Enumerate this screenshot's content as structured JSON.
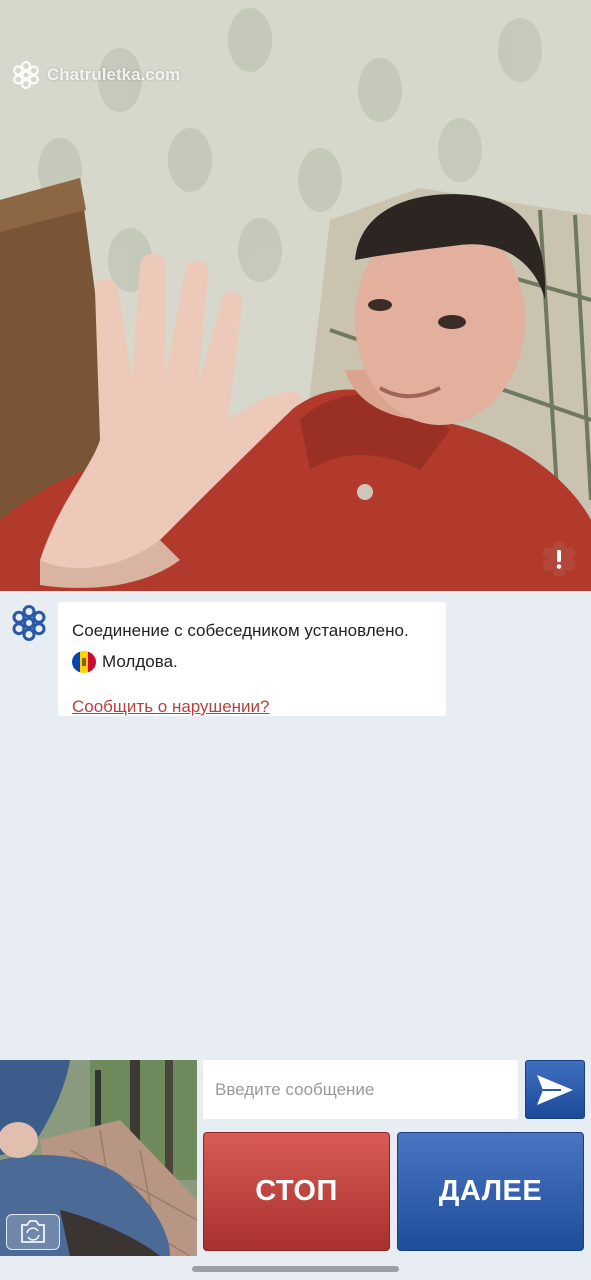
{
  "app": {
    "brand": "Chatruletka.com"
  },
  "remote_video": {
    "watermark": "Chatruletka.com",
    "report_icon": "exclamation-badge-icon"
  },
  "chat": {
    "message": {
      "text": "Соединение с собеседником установлено.",
      "country": "Молдова.",
      "country_flag": [
        "#0046ae",
        "#ffd200",
        "#cc092f"
      ],
      "report_link": "Сообщить о нарушении?"
    }
  },
  "composer": {
    "placeholder": "Введите сообщение",
    "send_icon": "send-arrow-icon"
  },
  "buttons": {
    "stop": "СТОП",
    "next": "ДАЛЕЕ"
  },
  "colors": {
    "stop_red": "#b8403c",
    "next_blue": "#2a58a8",
    "background": "#e7edf2"
  }
}
